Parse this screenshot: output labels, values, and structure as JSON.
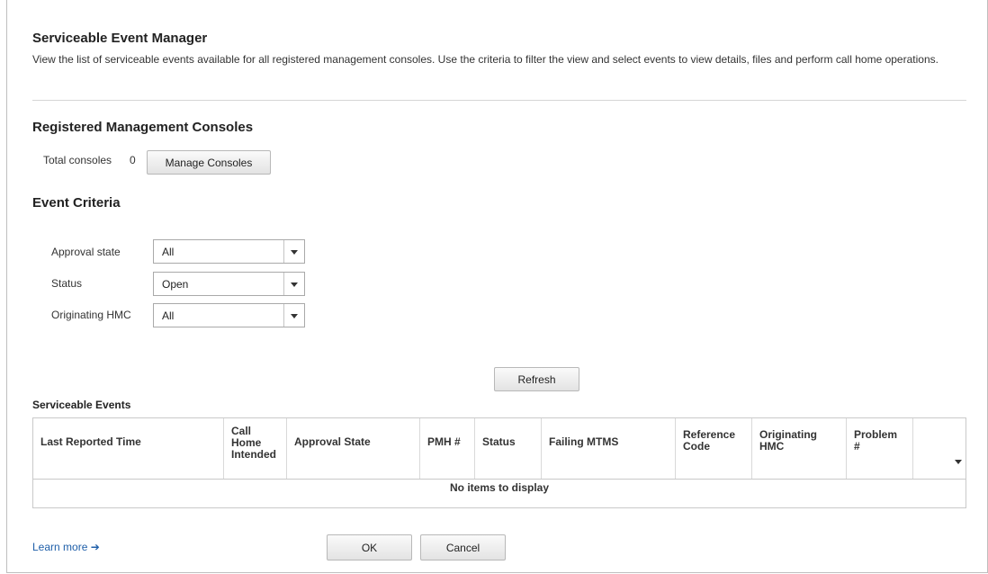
{
  "page": {
    "title": "Serviceable Event Manager",
    "description": "View the list of serviceable events available for all registered management consoles. Use the criteria to filter the view and select events to view details, files and perform call home operations."
  },
  "consoles": {
    "heading": "Registered Management Consoles",
    "total_label": "Total consoles",
    "total_value": "0",
    "manage_button": "Manage Consoles"
  },
  "criteria": {
    "heading": "Event Criteria",
    "approval_label": "Approval state",
    "approval_value": "All",
    "status_label": "Status",
    "status_value": "Open",
    "hmc_label": "Originating HMC",
    "hmc_value": "All",
    "refresh_button": "Refresh"
  },
  "events": {
    "heading": "Serviceable Events",
    "columns": [
      "Last Reported Time",
      "Call Home Intended",
      "Approval State",
      "PMH #",
      "Status",
      "Failing MTMS",
      "Reference Code",
      "Originating HMC",
      "Problem #"
    ],
    "empty_text": "No items to display"
  },
  "footer": {
    "learn_more": "Learn more ➔",
    "ok_button": "OK",
    "cancel_button": "Cancel"
  }
}
